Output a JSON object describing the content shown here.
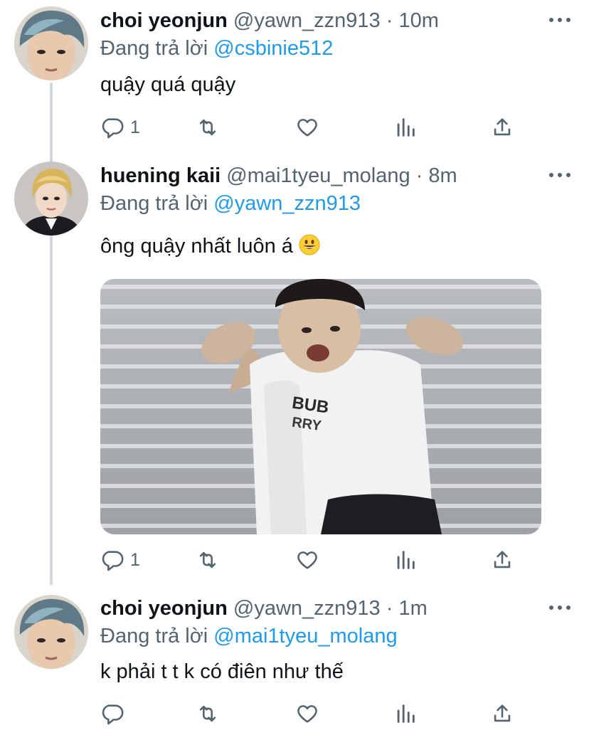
{
  "tweets": [
    {
      "name": "choi yeonjun",
      "handle": "@yawn_zzn913",
      "dot": "·",
      "time": "10m",
      "reply_prefix": "Đang trả lời",
      "reply_to": "@csbinie512",
      "text": "quậy quá quậy",
      "reply_count": "1"
    },
    {
      "name": "huening kaii",
      "handle": "@mai1tyeu_molang",
      "dot": "·",
      "time": "8m",
      "reply_prefix": "Đang trả lời",
      "reply_to": "@yawn_zzn913",
      "text": "ông quậy nhất luôn á",
      "emoji": "grinning-face",
      "reply_count": "1"
    },
    {
      "name": "choi yeonjun",
      "handle": "@yawn_zzn913",
      "dot": "·",
      "time": "1m",
      "reply_prefix": "Đang trả lời",
      "reply_to": "@mai1tyeu_molang",
      "text": "k phải t t k có điên như thế",
      "reply_count": ""
    }
  ],
  "media_print": {
    "line1": "BUB",
    "line2": "RRY"
  },
  "icons": {
    "reply": "reply-icon",
    "retweet": "retweet-icon",
    "like": "like-icon",
    "stats": "stats-icon",
    "share": "share-icon",
    "more": "more-icon"
  },
  "colors": {
    "text": "#0f1419",
    "secondary": "#536471",
    "link": "#1d9bf0",
    "thread_line": "#cfd9de"
  }
}
